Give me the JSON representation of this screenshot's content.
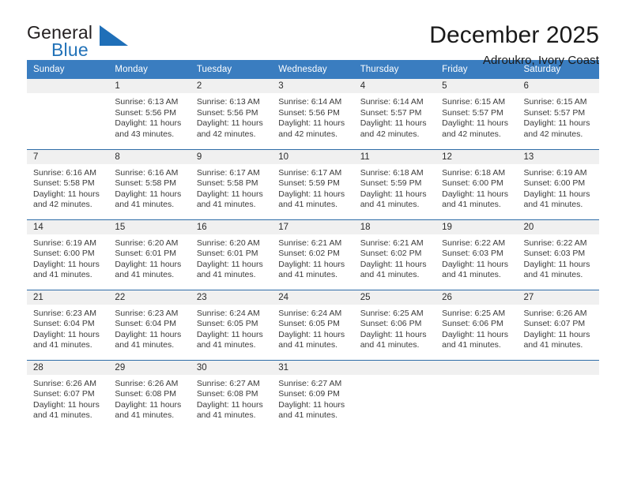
{
  "brand": {
    "name_top": "General",
    "name_bottom": "Blue",
    "triangle_icon": "triangle-icon",
    "color_dark": "#231f20",
    "color_blue": "#2272b8"
  },
  "header": {
    "title": "December 2025",
    "subtitle": "Adroukro, Ivory Coast"
  },
  "theme": {
    "header_row_bg": "#3a7dc0",
    "row_divider": "#2f6da8",
    "daynum_band_bg": "#f0f0f0",
    "text": "#3b3b3b"
  },
  "columns": [
    "Sunday",
    "Monday",
    "Tuesday",
    "Wednesday",
    "Thursday",
    "Friday",
    "Saturday"
  ],
  "weeks": [
    [
      {
        "day": "",
        "empty": true,
        "sunrise": "",
        "sunset": "",
        "daylight_line1": "",
        "daylight_line2": ""
      },
      {
        "day": "1",
        "sunrise": "Sunrise: 6:13 AM",
        "sunset": "Sunset: 5:56 PM",
        "daylight_line1": "Daylight: 11 hours",
        "daylight_line2": "and 43 minutes."
      },
      {
        "day": "2",
        "sunrise": "Sunrise: 6:13 AM",
        "sunset": "Sunset: 5:56 PM",
        "daylight_line1": "Daylight: 11 hours",
        "daylight_line2": "and 42 minutes."
      },
      {
        "day": "3",
        "sunrise": "Sunrise: 6:14 AM",
        "sunset": "Sunset: 5:56 PM",
        "daylight_line1": "Daylight: 11 hours",
        "daylight_line2": "and 42 minutes."
      },
      {
        "day": "4",
        "sunrise": "Sunrise: 6:14 AM",
        "sunset": "Sunset: 5:57 PM",
        "daylight_line1": "Daylight: 11 hours",
        "daylight_line2": "and 42 minutes."
      },
      {
        "day": "5",
        "sunrise": "Sunrise: 6:15 AM",
        "sunset": "Sunset: 5:57 PM",
        "daylight_line1": "Daylight: 11 hours",
        "daylight_line2": "and 42 minutes."
      },
      {
        "day": "6",
        "sunrise": "Sunrise: 6:15 AM",
        "sunset": "Sunset: 5:57 PM",
        "daylight_line1": "Daylight: 11 hours",
        "daylight_line2": "and 42 minutes."
      }
    ],
    [
      {
        "day": "7",
        "sunrise": "Sunrise: 6:16 AM",
        "sunset": "Sunset: 5:58 PM",
        "daylight_line1": "Daylight: 11 hours",
        "daylight_line2": "and 42 minutes."
      },
      {
        "day": "8",
        "sunrise": "Sunrise: 6:16 AM",
        "sunset": "Sunset: 5:58 PM",
        "daylight_line1": "Daylight: 11 hours",
        "daylight_line2": "and 41 minutes."
      },
      {
        "day": "9",
        "sunrise": "Sunrise: 6:17 AM",
        "sunset": "Sunset: 5:58 PM",
        "daylight_line1": "Daylight: 11 hours",
        "daylight_line2": "and 41 minutes."
      },
      {
        "day": "10",
        "sunrise": "Sunrise: 6:17 AM",
        "sunset": "Sunset: 5:59 PM",
        "daylight_line1": "Daylight: 11 hours",
        "daylight_line2": "and 41 minutes."
      },
      {
        "day": "11",
        "sunrise": "Sunrise: 6:18 AM",
        "sunset": "Sunset: 5:59 PM",
        "daylight_line1": "Daylight: 11 hours",
        "daylight_line2": "and 41 minutes."
      },
      {
        "day": "12",
        "sunrise": "Sunrise: 6:18 AM",
        "sunset": "Sunset: 6:00 PM",
        "daylight_line1": "Daylight: 11 hours",
        "daylight_line2": "and 41 minutes."
      },
      {
        "day": "13",
        "sunrise": "Sunrise: 6:19 AM",
        "sunset": "Sunset: 6:00 PM",
        "daylight_line1": "Daylight: 11 hours",
        "daylight_line2": "and 41 minutes."
      }
    ],
    [
      {
        "day": "14",
        "sunrise": "Sunrise: 6:19 AM",
        "sunset": "Sunset: 6:00 PM",
        "daylight_line1": "Daylight: 11 hours",
        "daylight_line2": "and 41 minutes."
      },
      {
        "day": "15",
        "sunrise": "Sunrise: 6:20 AM",
        "sunset": "Sunset: 6:01 PM",
        "daylight_line1": "Daylight: 11 hours",
        "daylight_line2": "and 41 minutes."
      },
      {
        "day": "16",
        "sunrise": "Sunrise: 6:20 AM",
        "sunset": "Sunset: 6:01 PM",
        "daylight_line1": "Daylight: 11 hours",
        "daylight_line2": "and 41 minutes."
      },
      {
        "day": "17",
        "sunrise": "Sunrise: 6:21 AM",
        "sunset": "Sunset: 6:02 PM",
        "daylight_line1": "Daylight: 11 hours",
        "daylight_line2": "and 41 minutes."
      },
      {
        "day": "18",
        "sunrise": "Sunrise: 6:21 AM",
        "sunset": "Sunset: 6:02 PM",
        "daylight_line1": "Daylight: 11 hours",
        "daylight_line2": "and 41 minutes."
      },
      {
        "day": "19",
        "sunrise": "Sunrise: 6:22 AM",
        "sunset": "Sunset: 6:03 PM",
        "daylight_line1": "Daylight: 11 hours",
        "daylight_line2": "and 41 minutes."
      },
      {
        "day": "20",
        "sunrise": "Sunrise: 6:22 AM",
        "sunset": "Sunset: 6:03 PM",
        "daylight_line1": "Daylight: 11 hours",
        "daylight_line2": "and 41 minutes."
      }
    ],
    [
      {
        "day": "21",
        "sunrise": "Sunrise: 6:23 AM",
        "sunset": "Sunset: 6:04 PM",
        "daylight_line1": "Daylight: 11 hours",
        "daylight_line2": "and 41 minutes."
      },
      {
        "day": "22",
        "sunrise": "Sunrise: 6:23 AM",
        "sunset": "Sunset: 6:04 PM",
        "daylight_line1": "Daylight: 11 hours",
        "daylight_line2": "and 41 minutes."
      },
      {
        "day": "23",
        "sunrise": "Sunrise: 6:24 AM",
        "sunset": "Sunset: 6:05 PM",
        "daylight_line1": "Daylight: 11 hours",
        "daylight_line2": "and 41 minutes."
      },
      {
        "day": "24",
        "sunrise": "Sunrise: 6:24 AM",
        "sunset": "Sunset: 6:05 PM",
        "daylight_line1": "Daylight: 11 hours",
        "daylight_line2": "and 41 minutes."
      },
      {
        "day": "25",
        "sunrise": "Sunrise: 6:25 AM",
        "sunset": "Sunset: 6:06 PM",
        "daylight_line1": "Daylight: 11 hours",
        "daylight_line2": "and 41 minutes."
      },
      {
        "day": "26",
        "sunrise": "Sunrise: 6:25 AM",
        "sunset": "Sunset: 6:06 PM",
        "daylight_line1": "Daylight: 11 hours",
        "daylight_line2": "and 41 minutes."
      },
      {
        "day": "27",
        "sunrise": "Sunrise: 6:26 AM",
        "sunset": "Sunset: 6:07 PM",
        "daylight_line1": "Daylight: 11 hours",
        "daylight_line2": "and 41 minutes."
      }
    ],
    [
      {
        "day": "28",
        "sunrise": "Sunrise: 6:26 AM",
        "sunset": "Sunset: 6:07 PM",
        "daylight_line1": "Daylight: 11 hours",
        "daylight_line2": "and 41 minutes."
      },
      {
        "day": "29",
        "sunrise": "Sunrise: 6:26 AM",
        "sunset": "Sunset: 6:08 PM",
        "daylight_line1": "Daylight: 11 hours",
        "daylight_line2": "and 41 minutes."
      },
      {
        "day": "30",
        "sunrise": "Sunrise: 6:27 AM",
        "sunset": "Sunset: 6:08 PM",
        "daylight_line1": "Daylight: 11 hours",
        "daylight_line2": "and 41 minutes."
      },
      {
        "day": "31",
        "sunrise": "Sunrise: 6:27 AM",
        "sunset": "Sunset: 6:09 PM",
        "daylight_line1": "Daylight: 11 hours",
        "daylight_line2": "and 41 minutes."
      },
      {
        "day": "",
        "empty": true,
        "sunrise": "",
        "sunset": "",
        "daylight_line1": "",
        "daylight_line2": ""
      },
      {
        "day": "",
        "empty": true,
        "sunrise": "",
        "sunset": "",
        "daylight_line1": "",
        "daylight_line2": ""
      },
      {
        "day": "",
        "empty": true,
        "sunrise": "",
        "sunset": "",
        "daylight_line1": "",
        "daylight_line2": ""
      }
    ]
  ]
}
